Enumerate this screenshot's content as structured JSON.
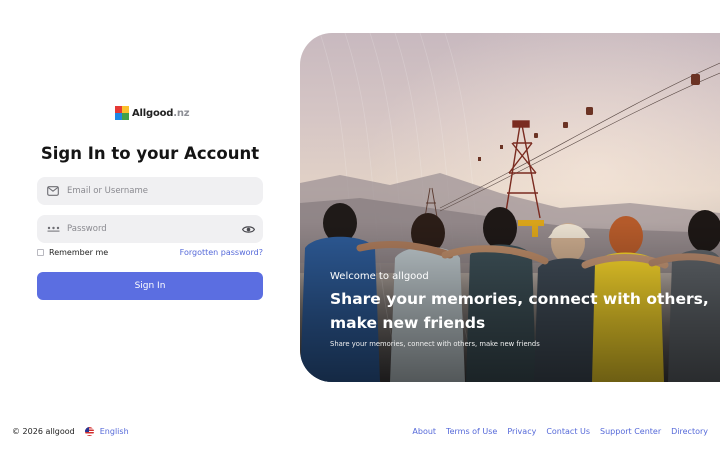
{
  "brand": {
    "logo_text_main": "Allgood",
    "logo_text_tld": ".nz"
  },
  "login": {
    "title": "Sign In to your Account",
    "email_placeholder": "Email or Username",
    "password_placeholder": "Password",
    "remember_label": "Remember me",
    "forgot_label": "Forgotten password?",
    "signin_label": "Sign In"
  },
  "hero": {
    "welcome": "Welcome to allgood",
    "headline_line1": "Share your memories, connect with others,",
    "headline_line2": "make new friends",
    "subtext": "Share your memories, connect with others, make new friends"
  },
  "footer": {
    "copyright": "© 2026 allgood",
    "language": "English",
    "links": [
      "About",
      "Terms of Use",
      "Privacy",
      "Contact Us",
      "Support Center",
      "Directory"
    ]
  },
  "colors": {
    "accent": "#5b6ee1",
    "link": "#5569d9",
    "input_bg": "#f0f0f2"
  },
  "icons": {
    "email": "mail-icon",
    "password": "password-dots-icon",
    "toggle": "eye-icon",
    "language": "us-flag-icon"
  }
}
